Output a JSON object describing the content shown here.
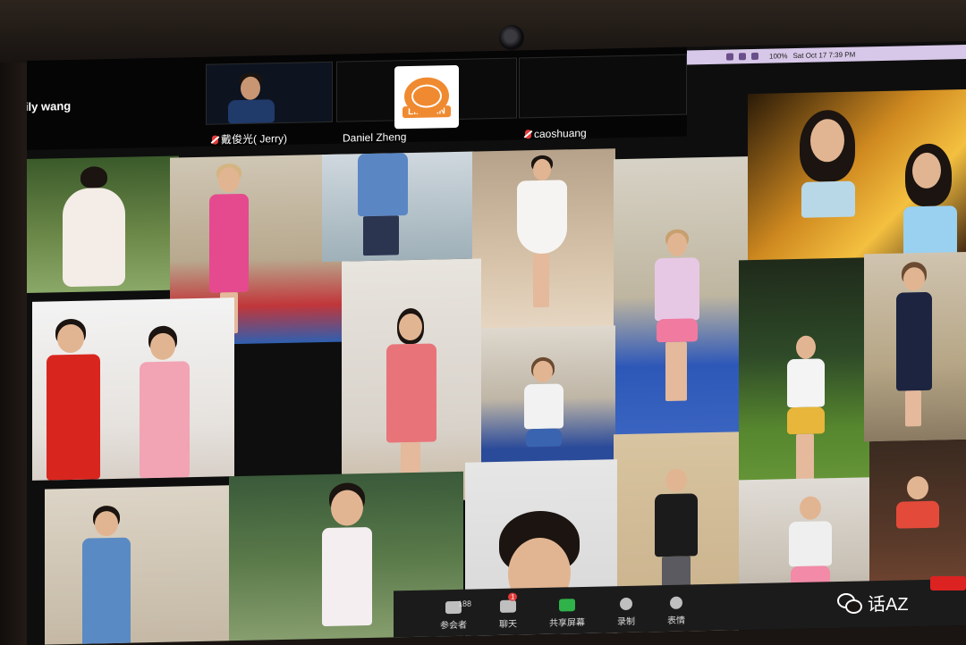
{
  "meeting": {
    "active_speaker": "Lily wang",
    "thumbnails": [
      {
        "name": "戴俊光( Jerry)",
        "muted": true
      },
      {
        "name": "Daniel Zheng",
        "muted": false
      },
      {
        "name": "caoshuang",
        "muted": true
      }
    ],
    "logo_text": "LIFEFAN"
  },
  "menubar": {
    "battery": "100%",
    "datetime": "Sat Oct 17 7:39 PM"
  },
  "toolbar": {
    "participants_count": "188",
    "participants_label": "参会者",
    "chat_label": "聊天",
    "chat_badge": "1",
    "share_label": "共享屏幕",
    "record_label": "录制",
    "reactions_label": "表情"
  },
  "watermark": {
    "text": "话AZ"
  },
  "colors": {
    "share_green": "#2fb24a",
    "muted_red": "#e23b3b",
    "logo_orange": "#f08a30"
  }
}
